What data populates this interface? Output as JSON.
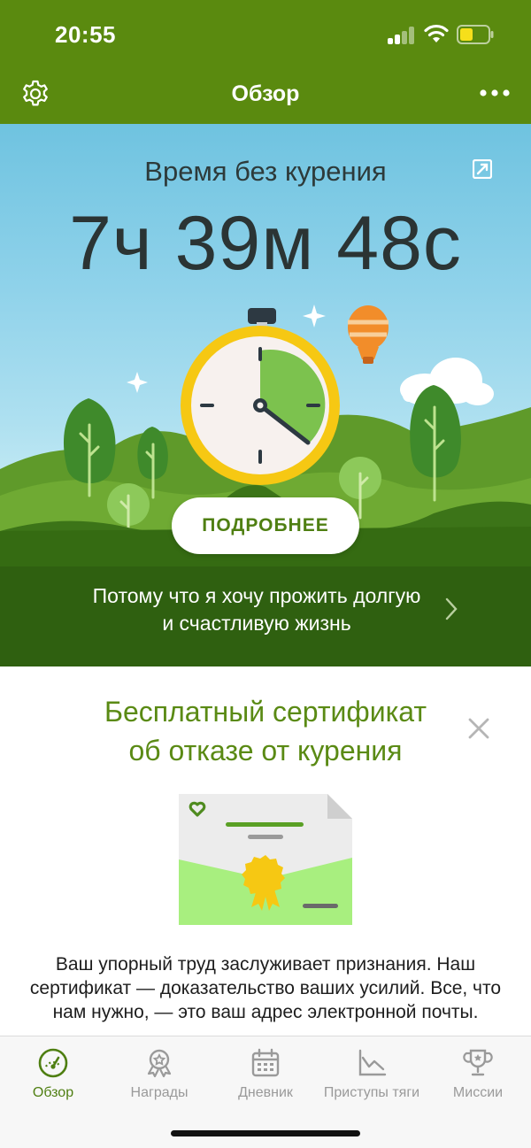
{
  "status_bar": {
    "time": "20:55"
  },
  "header": {
    "title": "Обзор"
  },
  "hero": {
    "label": "Время без курения",
    "timer": "7ч 39м 48с",
    "details_button": "ПОДРОБНЕЕ",
    "motivation_line1": "Потому что я хочу прожить долгую",
    "motivation_line2": "и счастливую жизнь",
    "stopwatch_progress": 0.35
  },
  "certificate_card": {
    "title_line1": "Бесплатный сертификат",
    "title_line2": "об отказе от курения",
    "body": "Ваш упорный труд заслуживает признания. Наш сертификат — доказательство ваших усилий. Все, что нам нужно, — это ваш адрес электронной почты."
  },
  "tabs": [
    {
      "label": "Обзор",
      "icon": "speedometer-icon",
      "active": true
    },
    {
      "label": "Награды",
      "icon": "award-icon",
      "active": false
    },
    {
      "label": "Дневник",
      "icon": "calendar-icon",
      "active": false
    },
    {
      "label": "Приступы тяги",
      "icon": "chart-icon",
      "active": false
    },
    {
      "label": "Миссии",
      "icon": "trophy-icon",
      "active": false
    }
  ],
  "colors": {
    "header_green": "#5a8a0f",
    "accent_green": "#4f7f12",
    "stopwatch_yellow": "#f6c813",
    "tab_inactive": "#9a9a9a"
  }
}
